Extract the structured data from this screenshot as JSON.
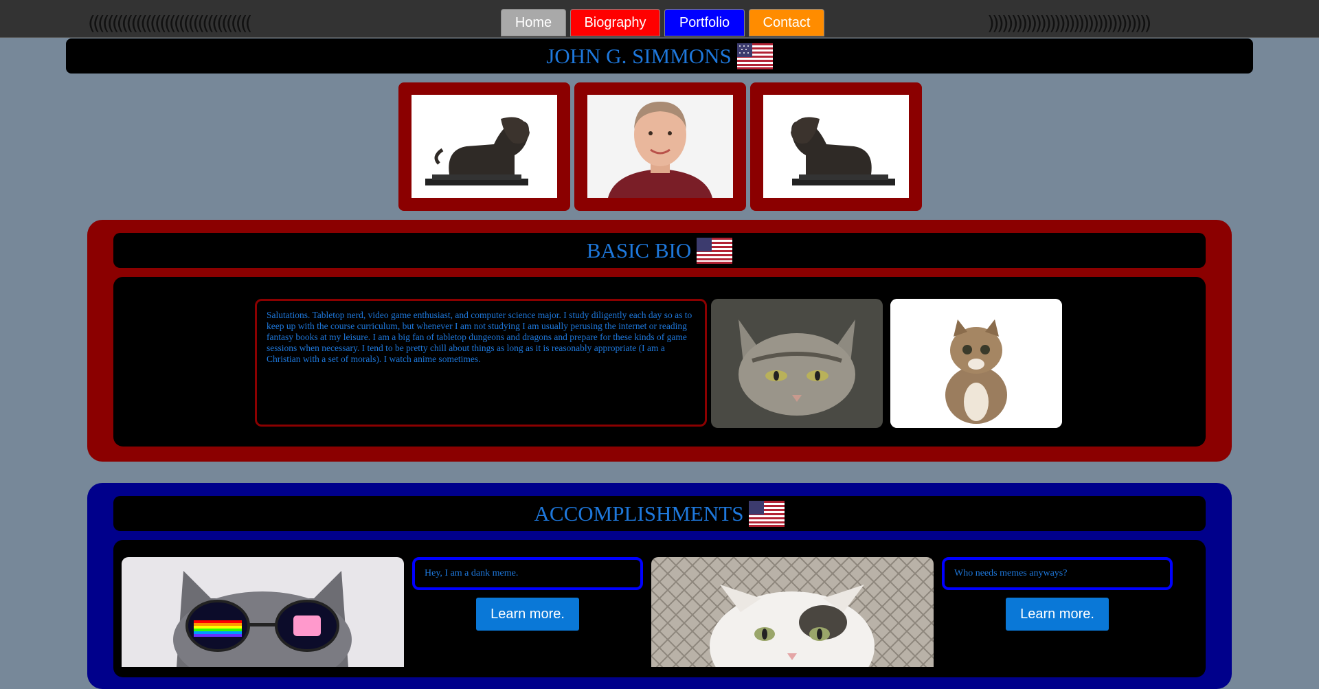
{
  "header": {
    "left_decor": "((((((((((((((((((((((((((((((((((",
    "right_decor": "))))))))))))))))))))))))))))))))))",
    "nav": [
      {
        "label": "Home",
        "color": "#a9a9a9"
      },
      {
        "label": "Biography",
        "color": "#ff0000"
      },
      {
        "label": "Portfolio",
        "color": "#0000ff"
      },
      {
        "label": "Contact",
        "color": "#ff8c00"
      }
    ]
  },
  "banner": {
    "title": "JOHN G. SIMMONS",
    "icon": "us-flag-icon"
  },
  "gallery": [
    {
      "image": "lion-statue"
    },
    {
      "image": "portrait-photo"
    },
    {
      "image": "lion-statue"
    }
  ],
  "bio": {
    "title": "BASIC BIO",
    "text": "Salutations. Tabletop nerd, video game enthusiast, and computer science major. I study diligently each day so as to keep up with the course curriculum, but whenever I am not studying I am usually perusing the internet or reading fantasy books at my leisure. I am a big fan of tabletop dungeons and dragons and prepare for these kinds of game sessions when necessary. I tend to be pretty chill about things as long as it is reasonably appropriate (I am a Christian with a set of morals). I watch anime sometimes.",
    "images": [
      "tabby-cat-photo",
      "kitten-photo"
    ]
  },
  "accomplishments": {
    "title": "ACCOMPLISHMENTS",
    "items": [
      {
        "image": "nyan-sunglasses-cat",
        "caption": "Hey, I am a dank meme.",
        "button": "Learn more."
      },
      {
        "image": "white-cat-fence",
        "caption": "Who needs memes anyways?",
        "button": "Learn more."
      }
    ]
  },
  "colors": {
    "accent_text": "#1e78dc",
    "page_bg": "#778899",
    "bio_bg": "#8b0000",
    "acc_bg": "#00008b"
  }
}
